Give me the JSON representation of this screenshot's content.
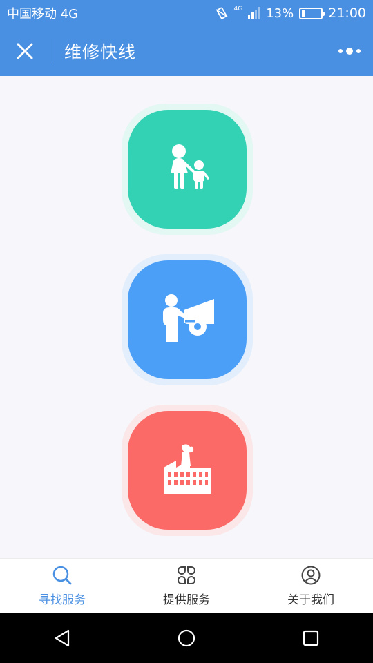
{
  "status_bar": {
    "carrier": "中国移动 4G",
    "network_tag": "4G",
    "battery": "13%",
    "battery_level": 0.13,
    "time": "21:00"
  },
  "header": {
    "title": "维修快线",
    "close_icon": "close-icon",
    "more_icon": "more-dots-icon"
  },
  "tiles": [
    {
      "icon": "parent-child-icon",
      "color": "#33d2b4"
    },
    {
      "icon": "car-repair-icon",
      "color": "#4b9ff7"
    },
    {
      "icon": "factory-icon",
      "color": "#fb6a66"
    }
  ],
  "tabbar": {
    "active_color": "#4a90e2",
    "items": [
      {
        "label": "寻找服务",
        "icon": "search-icon",
        "active": true
      },
      {
        "label": "提供服务",
        "icon": "services-grid-icon",
        "active": false
      },
      {
        "label": "关于我们",
        "icon": "user-icon",
        "active": false
      }
    ]
  },
  "nav": {
    "back_icon": "back-triangle-icon",
    "home_icon": "home-circle-icon",
    "recent_icon": "recent-square-icon"
  }
}
